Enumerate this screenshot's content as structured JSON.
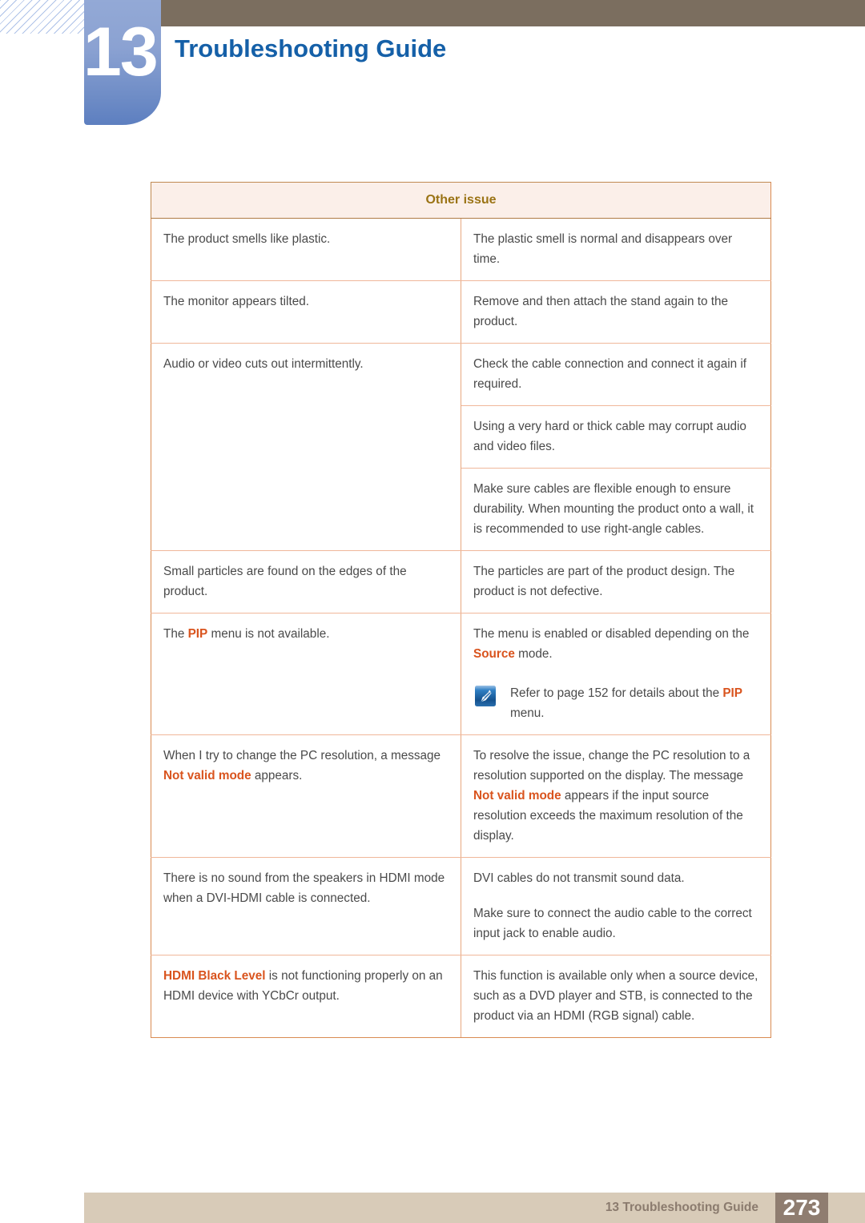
{
  "header": {
    "chapter_number": "13",
    "title": "Troubleshooting Guide",
    "title_color": "#1560a8",
    "bar_color": "#7b6e5f",
    "chapter_block_color": "#6e8cc6"
  },
  "table": {
    "header_label": "Other issue",
    "header_text_color": "#9a7314",
    "header_bg_color": "#fbefe9",
    "highlight_color": "#d9541e",
    "rows": [
      {
        "question": "The product smells like plastic.",
        "answers": [
          "The plastic smell is normal and disappears over time."
        ]
      },
      {
        "question": "The monitor appears tilted.",
        "answers": [
          "Remove and then attach the stand again to the product."
        ]
      },
      {
        "question": "Audio or video cuts out intermittently.",
        "answers": [
          "Check the cable connection and connect it again if required.",
          "Using a very hard or thick cable may corrupt audio and video files.",
          "Make sure cables are flexible enough to ensure durability. When mounting the product onto a wall, it is recommended to use right-angle cables."
        ]
      },
      {
        "question": "Small particles are found on the edges of the product.",
        "answers": [
          "The particles are part of the product design. The product is not defective."
        ]
      },
      {
        "question_parts": [
          {
            "text": "The ",
            "hl": false
          },
          {
            "text": "PIP",
            "hl": true
          },
          {
            "text": " menu is not available.",
            "hl": false
          }
        ],
        "answer_parts": [
          {
            "text": "The menu is enabled or disabled depending on the ",
            "hl": false
          },
          {
            "text": "Source",
            "hl": true
          },
          {
            "text": " mode.",
            "hl": false
          }
        ],
        "note": {
          "icon": "note-pen-icon",
          "parts": [
            {
              "text": "Refer to page 152 for details about the ",
              "hl": false
            },
            {
              "text": "PIP",
              "hl": true
            },
            {
              "text": " menu.",
              "hl": false
            }
          ]
        }
      },
      {
        "question_parts": [
          {
            "text": "When I try to change the PC resolution, a message ",
            "hl": false
          },
          {
            "text": "Not valid mode",
            "hl": true
          },
          {
            "text": " appears.",
            "hl": false
          }
        ],
        "answers_parts": [
          [
            {
              "text": "To resolve the issue, change the PC resolution to a resolution supported on the display. The message ",
              "hl": false
            },
            {
              "text": "Not valid mode",
              "hl": true
            },
            {
              "text": " appears if the input source resolution exceeds the maximum resolution of the display.",
              "hl": false
            }
          ]
        ]
      },
      {
        "question": "There is no sound from the speakers in HDMI mode when a DVI-HDMI cable is connected.",
        "answers": [
          "DVI cables do not transmit sound data.",
          "Make sure to connect the audio cable to the correct input jack to enable audio."
        ]
      },
      {
        "question_parts": [
          {
            "text": "HDMI Black Level",
            "hl": true
          },
          {
            "text": " is not functioning properly on an HDMI device with YCbCr output.",
            "hl": false
          }
        ],
        "answers": [
          "This function is available only when a source device, such as a DVD player and STB, is connected to the product via an HDMI (RGB signal) cable."
        ]
      }
    ]
  },
  "footer": {
    "label": "13 Troubleshooting Guide",
    "page_number": "273",
    "bar_color": "#d8cbb8",
    "page_box_color": "#8f7d70"
  }
}
